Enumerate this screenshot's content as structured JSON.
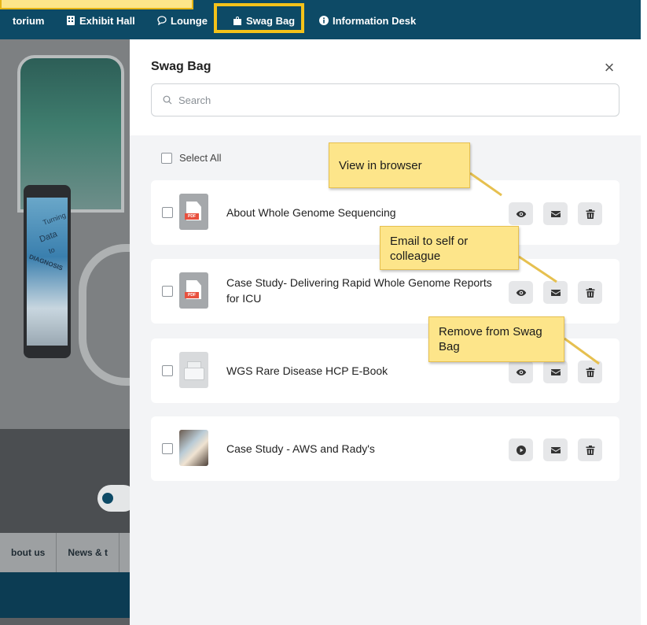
{
  "nav": {
    "items": [
      {
        "label": "torium",
        "icon": "auditorium-icon"
      },
      {
        "label": "Exhibit Hall",
        "icon": "building-icon"
      },
      {
        "label": "Lounge",
        "icon": "chat-icon"
      },
      {
        "label": "Swag Bag",
        "icon": "bag-icon"
      },
      {
        "label": "Information Desk",
        "icon": "info-icon"
      }
    ],
    "active": "Swag Bag"
  },
  "background": {
    "kiosk_lines": [
      "Turning",
      "Data",
      "to",
      "DIAGNOSIS"
    ],
    "footer_links": [
      "bout us",
      "News & t"
    ]
  },
  "panel": {
    "title": "Swag Bag",
    "close_label": "×",
    "search_placeholder": "Search",
    "select_all_label": "Select All",
    "items": [
      {
        "title": "About Whole Genome Sequencing",
        "type": "pdf",
        "thumb_label": "PDF",
        "primary_action": "eye-icon"
      },
      {
        "title": "Case Study- Delivering Rapid Whole Genome Reports for ICU",
        "type": "pdf",
        "thumb_label": "PDF",
        "primary_action": "eye-icon"
      },
      {
        "title": "WGS Rare Disease HCP E-Book",
        "type": "document",
        "primary_action": "eye-icon"
      },
      {
        "title": "Case Study - AWS and Rady's",
        "type": "video",
        "primary_action": "play-icon"
      }
    ]
  },
  "callouts": {
    "view": "View in browser",
    "email": "Email to self or colleague",
    "remove": "Remove from Swag Bag"
  },
  "colors": {
    "nav_bg": "#0d4a66",
    "highlight": "#f4c21a",
    "callout_bg": "#fde58a",
    "panel_bg": "#f3f4f6",
    "pdf_red": "#e8503e"
  }
}
